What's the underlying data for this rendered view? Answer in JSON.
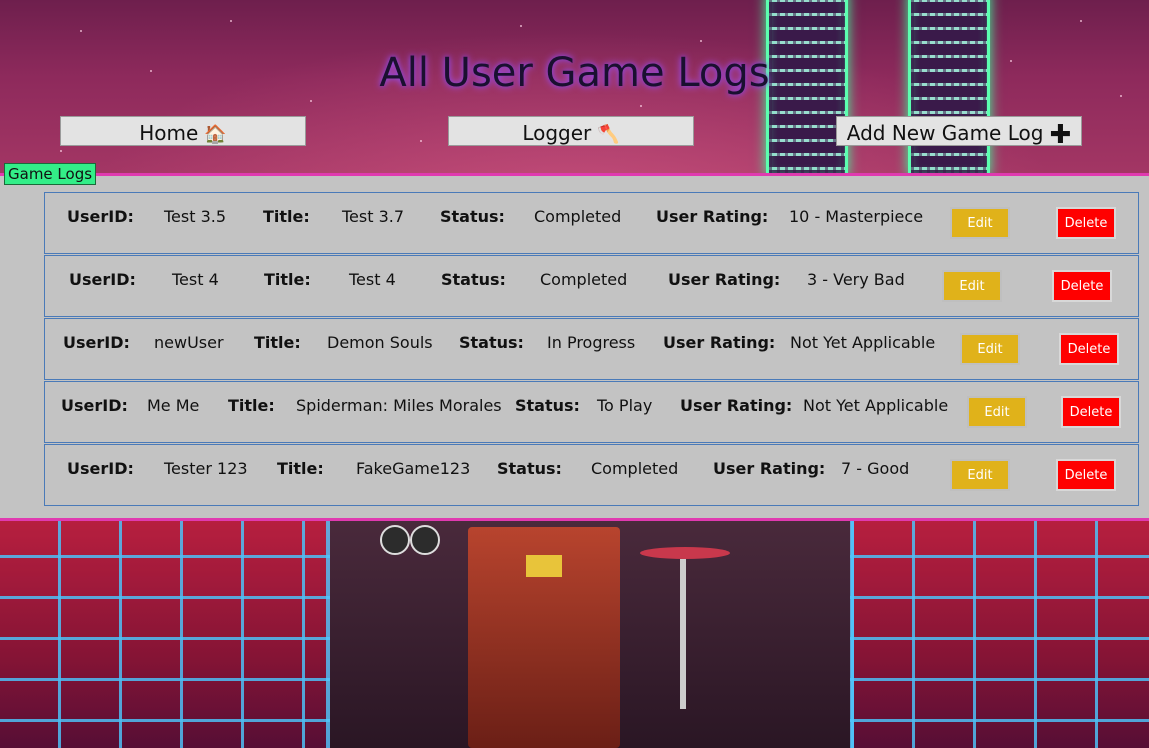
{
  "header": {
    "title": "All User Game Logs"
  },
  "nav": {
    "home_label": "Home",
    "home_icon": "house-icon",
    "logger_label": "Logger",
    "logger_icon": "axe-icon",
    "add_label": "Add New Game Log",
    "add_icon": "plus-icon"
  },
  "section": {
    "label": "Game Logs"
  },
  "field_labels": {
    "user_id": "UserID:",
    "title": "Title:",
    "status": "Status:",
    "rating": "User Rating:"
  },
  "actions": {
    "edit_label": "Edit",
    "delete_label": "Delete"
  },
  "logs": [
    {
      "user_id": "Test 3.5",
      "title": "Test 3.7",
      "status": "Completed",
      "rating": "10 - Masterpiece"
    },
    {
      "user_id": "Test 4",
      "title": "Test 4",
      "status": "Completed",
      "rating": "3 - Very Bad"
    },
    {
      "user_id": "newUser",
      "title": "Demon Souls",
      "status": "In Progress",
      "rating": "Not Yet Applicable"
    },
    {
      "user_id": "Me Me",
      "title": "Spiderman: Miles Morales",
      "status": "To Play",
      "rating": "Not Yet Applicable"
    },
    {
      "user_id": "Tester 123",
      "title": "FakeGame123",
      "status": "Completed",
      "rating": "7 - Good"
    }
  ],
  "colors": {
    "accent_border": "#e03ab0",
    "section_label_bg": "#33ee88",
    "edit_button": "#e0b21a",
    "delete_button": "#ff0000",
    "card_border": "#4a7ab8"
  }
}
